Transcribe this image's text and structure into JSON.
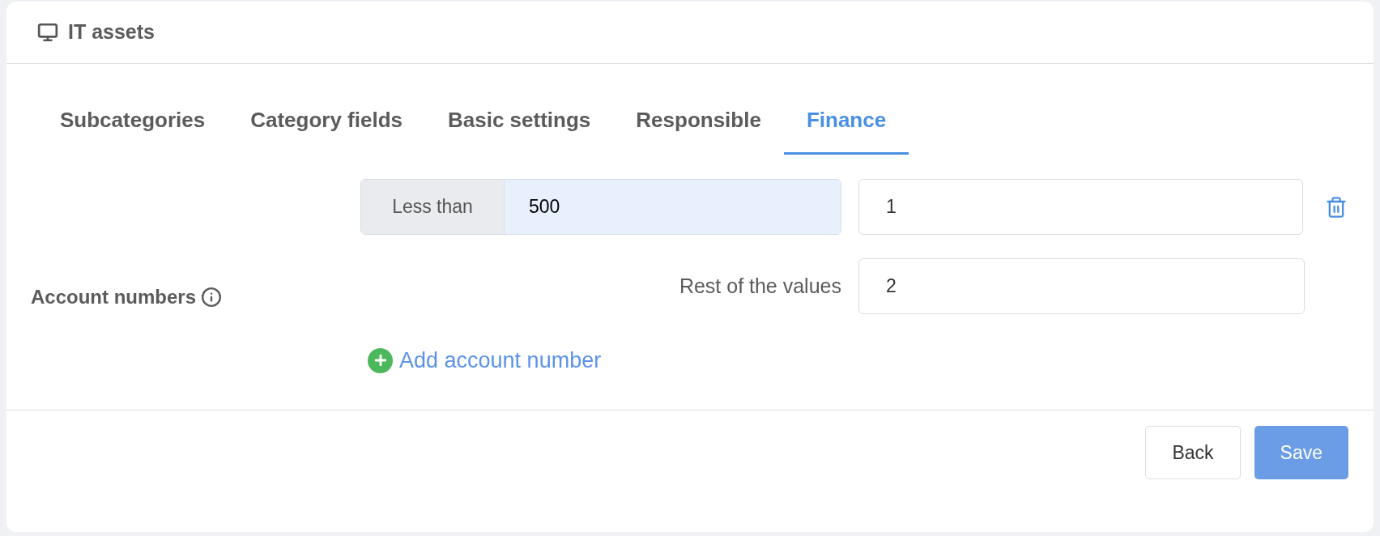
{
  "card": {
    "title": "IT assets"
  },
  "tabs": [
    {
      "label": "Subcategories",
      "selected": false
    },
    {
      "label": "Category fields",
      "selected": false
    },
    {
      "label": "Basic settings",
      "selected": false
    },
    {
      "label": "Responsible",
      "selected": false
    },
    {
      "label": "Finance",
      "selected": true
    }
  ],
  "account_numbers": {
    "label": "Account numbers",
    "ranges": [
      {
        "condition": "Less than",
        "threshold": "500",
        "account": "1"
      }
    ],
    "rest": {
      "label": "Rest of the values",
      "account": "2"
    },
    "add_link": "Add account number"
  },
  "buttons": [
    {
      "label": "Back",
      "kind": "secondary"
    },
    {
      "label": "Save",
      "kind": "primary"
    }
  ]
}
